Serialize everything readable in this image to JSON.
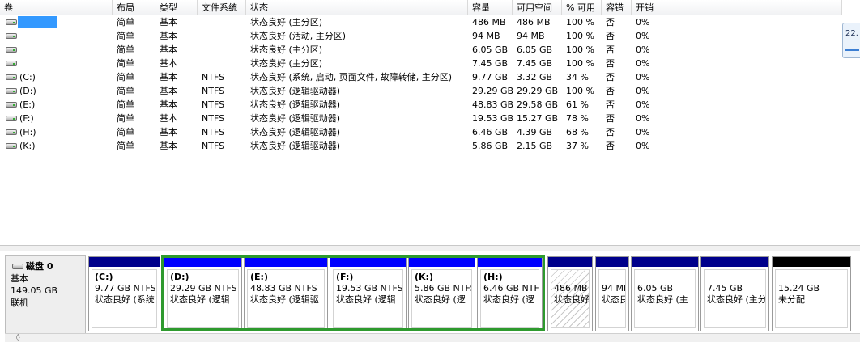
{
  "columns": [
    {
      "key": "vol",
      "label": "卷"
    },
    {
      "key": "layout",
      "label": "布局"
    },
    {
      "key": "type",
      "label": "类型"
    },
    {
      "key": "fs",
      "label": "文件系统"
    },
    {
      "key": "status",
      "label": "状态"
    },
    {
      "key": "capacity",
      "label": "容量"
    },
    {
      "key": "free",
      "label": "可用空间"
    },
    {
      "key": "pct",
      "label": "% 可用"
    },
    {
      "key": "fault",
      "label": "容错"
    },
    {
      "key": "overhead",
      "label": "开销"
    }
  ],
  "volumes": [
    {
      "vol": "",
      "selected": true,
      "layout": "简单",
      "type": "基本",
      "fs": "",
      "status": "状态良好 (主分区)",
      "capacity": "486 MB",
      "free": "486 MB",
      "pct": "100 %",
      "fault": "否",
      "overhead": "0%"
    },
    {
      "vol": "",
      "layout": "简单",
      "type": "基本",
      "fs": "",
      "status": "状态良好 (活动, 主分区)",
      "capacity": "94 MB",
      "free": "94 MB",
      "pct": "100 %",
      "fault": "否",
      "overhead": "0%"
    },
    {
      "vol": "",
      "layout": "简单",
      "type": "基本",
      "fs": "",
      "status": "状态良好 (主分区)",
      "capacity": "6.05 GB",
      "free": "6.05 GB",
      "pct": "100 %",
      "fault": "否",
      "overhead": "0%"
    },
    {
      "vol": "",
      "layout": "简单",
      "type": "基本",
      "fs": "",
      "status": "状态良好 (主分区)",
      "capacity": "7.45 GB",
      "free": "7.45 GB",
      "pct": "100 %",
      "fault": "否",
      "overhead": "0%"
    },
    {
      "vol": "(C:)",
      "layout": "简单",
      "type": "基本",
      "fs": "NTFS",
      "status": "状态良好 (系统, 启动, 页面文件, 故障转储, 主分区)",
      "capacity": "9.77 GB",
      "free": "3.32 GB",
      "pct": "34 %",
      "fault": "否",
      "overhead": "0%"
    },
    {
      "vol": "(D:)",
      "layout": "简单",
      "type": "基本",
      "fs": "NTFS",
      "status": "状态良好 (逻辑驱动器)",
      "capacity": "29.29 GB",
      "free": "29.29 GB",
      "pct": "100 %",
      "fault": "否",
      "overhead": "0%"
    },
    {
      "vol": "(E:)",
      "layout": "简单",
      "type": "基本",
      "fs": "NTFS",
      "status": "状态良好 (逻辑驱动器)",
      "capacity": "48.83 GB",
      "free": "29.58 GB",
      "pct": "61 %",
      "fault": "否",
      "overhead": "0%"
    },
    {
      "vol": "(F:)",
      "layout": "简单",
      "type": "基本",
      "fs": "NTFS",
      "status": "状态良好 (逻辑驱动器)",
      "capacity": "19.53 GB",
      "free": "15.27 GB",
      "pct": "78 %",
      "fault": "否",
      "overhead": "0%"
    },
    {
      "vol": "(H:)",
      "layout": "简单",
      "type": "基本",
      "fs": "NTFS",
      "status": "状态良好 (逻辑驱动器)",
      "capacity": "6.46 GB",
      "free": "4.39 GB",
      "pct": "68 %",
      "fault": "否",
      "overhead": "0%"
    },
    {
      "vol": "(K:)",
      "layout": "简单",
      "type": "基本",
      "fs": "NTFS",
      "status": "状态良好 (逻辑驱动器)",
      "capacity": "5.86 GB",
      "free": "2.15 GB",
      "pct": "37 %",
      "fault": "否",
      "overhead": "0%"
    }
  ],
  "side_widget": {
    "text": "22."
  },
  "disk": {
    "title": "磁盘 0",
    "type": "基本",
    "size": "149.05 GB",
    "state": "联机"
  },
  "partitions": [
    {
      "name": "(C:)",
      "size": "9.77 GB NTFS",
      "status": "状态良好 (系统",
      "bar_color": "#00008b",
      "hatched": false
    },
    {
      "name": "(D:)",
      "size": "29.29 GB NTFS",
      "status": "状态良好 (逻辑",
      "bar_color": "#0000ff",
      "hatched": false
    },
    {
      "name": "(E:)",
      "size": "48.83 GB NTFS",
      "status": "状态良好 (逻辑驱",
      "bar_color": "#0000ff",
      "hatched": false
    },
    {
      "name": "(F:)",
      "size": "19.53 GB NTFS",
      "status": "状态良好 (逻辑",
      "bar_color": "#0000ff",
      "hatched": false
    },
    {
      "name": "(K:)",
      "size": "5.86 GB NTFS",
      "status": "状态良好 (逻",
      "bar_color": "#0000ff",
      "hatched": false
    },
    {
      "name": "(H:)",
      "size": "6.46 GB NTF",
      "status": "状态良好 (逻",
      "bar_color": "#0000ff",
      "hatched": false
    },
    {
      "name": "",
      "size": "486 MB",
      "status": "状态良好",
      "bar_color": "#00008b",
      "hatched": true
    },
    {
      "name": "",
      "size": "94 MI",
      "status": "状态良",
      "bar_color": "#00008b",
      "hatched": false
    },
    {
      "name": "",
      "size": "6.05 GB",
      "status": "状态良好 (主",
      "bar_color": "#00008b",
      "hatched": false
    },
    {
      "name": "",
      "size": "7.45 GB",
      "status": "状态良好 (主分",
      "bar_color": "#00008b",
      "hatched": false
    },
    {
      "name": "",
      "size": "15.24 GB",
      "status": "未分配",
      "bar_color": "#000000",
      "hatched": false
    }
  ],
  "bottom_strip": {
    "text": "◊"
  }
}
